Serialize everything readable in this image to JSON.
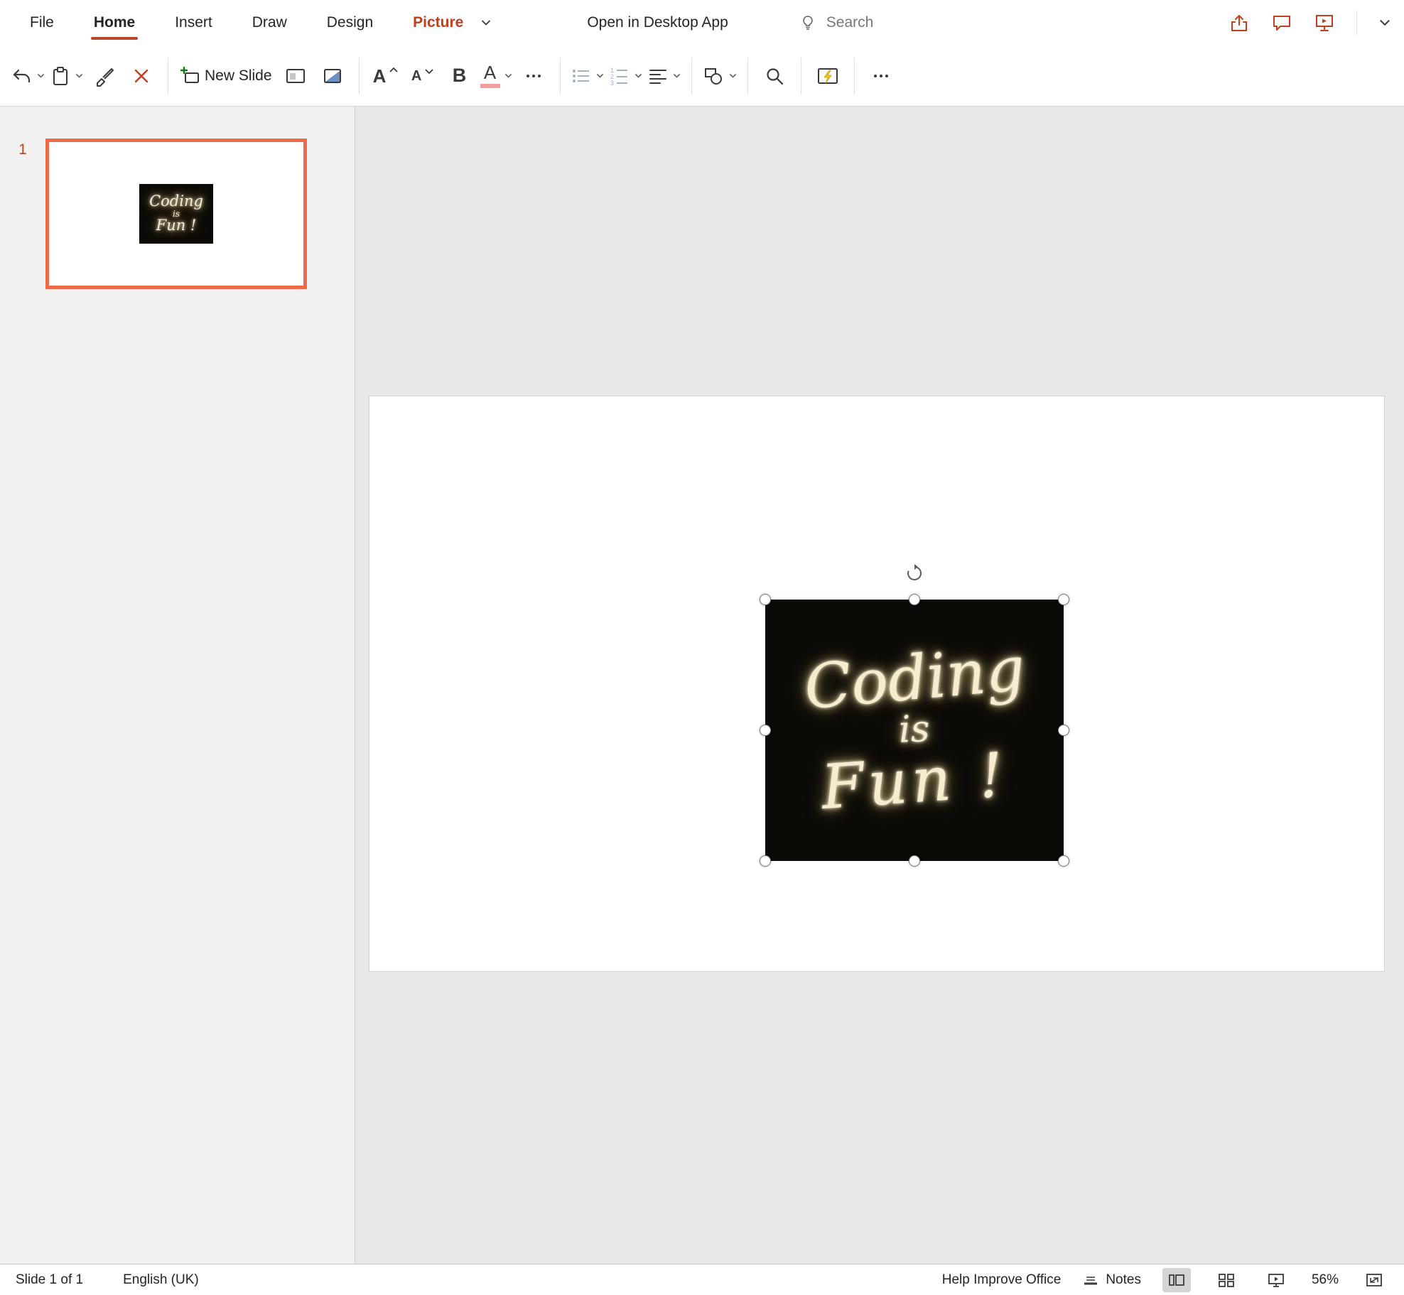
{
  "menu": {
    "tabs": [
      {
        "label": "File"
      },
      {
        "label": "Home"
      },
      {
        "label": "Insert"
      },
      {
        "label": "Draw"
      },
      {
        "label": "Design"
      },
      {
        "label": "Picture"
      }
    ],
    "open_in_desktop": "Open in Desktop App",
    "search_label": "Search"
  },
  "ribbon": {
    "new_slide_label": "New Slide",
    "font_increase_glyph": "A",
    "font_decrease_glyph": "A",
    "bold_glyph": "B",
    "font_color_glyph": "A"
  },
  "thumbnail_panel": {
    "slide_number": "1"
  },
  "slide": {
    "picture_text_line1": "Coding",
    "picture_text_line2": "is",
    "picture_text_line3": "Fun !"
  },
  "status_bar": {
    "slide_indicator": "Slide 1 of 1",
    "language": "English (UK)",
    "help_improve": "Help Improve Office",
    "notes_label": "Notes",
    "zoom_level": "56%"
  },
  "colors": {
    "accent_red": "#C43E1C",
    "tab_underline": "#B7472A",
    "selection_orange": "#ED6C47",
    "font_color_bar": "#EF9D9D",
    "designer_bolt": "#F7C325",
    "neon_text": "#F6ECCF"
  }
}
